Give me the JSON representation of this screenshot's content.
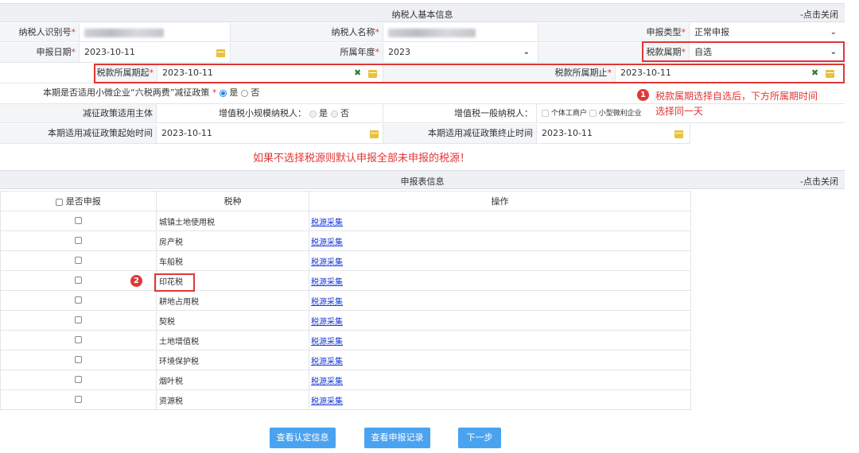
{
  "taxpayer_section": {
    "title": "纳税人基本信息",
    "close_label": "-点击关闭"
  },
  "fields": {
    "taxpayer_id_label": "纳税人识别号",
    "taxpayer_name_label": "纳税人名称",
    "declare_type_label": "申报类型",
    "declare_type_value": "正常申报",
    "declare_date_label": "申报日期",
    "declare_date_value": "2023-10-11",
    "year_label": "所属年度",
    "year_value": "2023",
    "period_label": "税款属期",
    "period_value": "自选",
    "period_start_label": "税款所属期起",
    "period_start_value": "2023-10-11",
    "period_end_label": "税款所属期止",
    "period_end_value": "2023-10-11",
    "six_tax_label": "本期是否适用小微企业“六税两费”减征政策",
    "yes": "是",
    "no": "否",
    "policy_subject_label": "减征政策适用主体",
    "small_vat_label": "增值税小规模纳税人：",
    "general_vat_label": "增值税一般纳税人：",
    "individual_label": "个体工商户",
    "small_profit_label": "小型微利企业",
    "policy_start_label": "本期适用减征政策起始时间",
    "policy_start_value": "2023-10-11",
    "policy_end_label": "本期适用减征政策终止时间",
    "policy_end_value": "2023-10-11"
  },
  "annotations": {
    "note1_line1": "税款属期选择自选后，下方所属期时间",
    "note1_line2": "选择同一天",
    "badge1": "1",
    "badge2": "2",
    "warning": "如果不选择税源则默认申报全部未申报的税源！"
  },
  "report_section": {
    "title": "申报表信息",
    "close_label": "-点击关闭"
  },
  "table": {
    "headers": [
      "是否申报",
      "税种",
      "操作"
    ],
    "rows": [
      {
        "tax": "城镇土地使用税",
        "action": "税源采集"
      },
      {
        "tax": "房产税",
        "action": "税源采集"
      },
      {
        "tax": "车船税",
        "action": "税源采集"
      },
      {
        "tax": "印花税",
        "action": "税源采集"
      },
      {
        "tax": "耕地占用税",
        "action": "税源采集"
      },
      {
        "tax": "契税",
        "action": "税源采集"
      },
      {
        "tax": "土地增值税",
        "action": "税源采集"
      },
      {
        "tax": "环境保护税",
        "action": "税源采集"
      },
      {
        "tax": "烟叶税",
        "action": "税源采集"
      },
      {
        "tax": "资源税",
        "action": "税源采集"
      }
    ]
  },
  "buttons": {
    "view_cert": "查看认定信息",
    "view_records": "查看申报记录",
    "next": "下一步"
  },
  "colors": {
    "accent": "#4aa3f0",
    "annotation_red": "#e23636",
    "link_blue": "#1a3cd6"
  }
}
